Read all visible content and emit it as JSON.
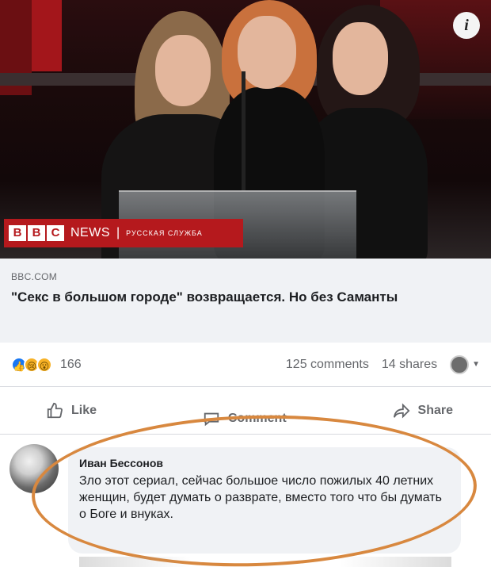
{
  "hero": {
    "info_icon": "i",
    "bbc_letters": [
      "B",
      "B",
      "C"
    ],
    "news_label": "NEWS",
    "separator": "|",
    "service_label": "РУССКАЯ СЛУЖБА"
  },
  "link": {
    "domain": "BBC.COM",
    "title": "\"Секс в большом городе\" возвращается. Но без Саманты"
  },
  "stats": {
    "reaction_icons": [
      "like-icon",
      "sad-icon",
      "wow-icon"
    ],
    "reaction_count": "166",
    "comments": "125 comments",
    "shares": "14 shares"
  },
  "actions": {
    "like": "Like",
    "comment": "Comment",
    "share": "Share"
  },
  "comment": {
    "author": "Иван Бессонов",
    "text": "Зло этот сериал, сейчас большое число пожилых 40 летних женщин, будет думать о разврате, вместо того что бы думать о Боге и внуках."
  },
  "colors": {
    "bbc_red": "#b5191d",
    "link_bg": "#f0f2f5",
    "highlight": "#d8883f",
    "like_blue": "#1877f2"
  }
}
